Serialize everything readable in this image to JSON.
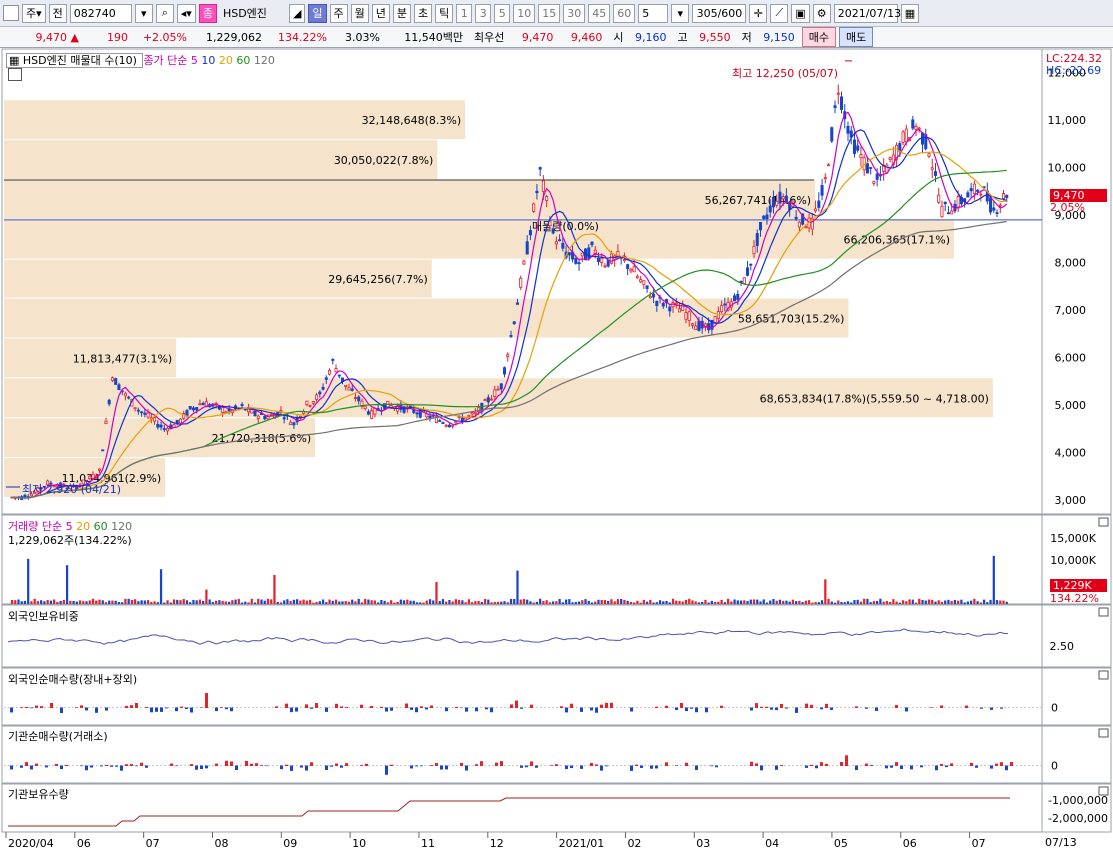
{
  "toolbar": {
    "period_type": "주",
    "prev_label": "전",
    "code": "082740",
    "name": "HSD엔진",
    "name_badge": "종",
    "periods": [
      "일",
      "주",
      "월",
      "년",
      "분",
      "초",
      "틱"
    ],
    "intervals": [
      "1",
      "3",
      "5",
      "10",
      "15",
      "30",
      "45",
      "60"
    ],
    "interval_value": "5",
    "count": "305",
    "count_max": "600",
    "date": "2021/07/13"
  },
  "quote": {
    "price": "9,470",
    "change": "190",
    "change_pct": "+2.05%",
    "volume": "1,229,062",
    "volume_ratio": "134.22%",
    "turnover": "3.03%",
    "amount": "11,540백만",
    "best_label": "최우선",
    "ask": "9,470",
    "bid": "9,460",
    "open_label": "시",
    "open": "9,160",
    "high_label": "고",
    "high": "9,550",
    "low_label": "저",
    "low": "9,150",
    "buy": "매수",
    "sell": "매도"
  },
  "main_pane": {
    "vp_label": "HSD엔진 매물대 수(10)",
    "ma_label": "종가 단순",
    "ma_periods": [
      "5",
      "10",
      "20",
      "60",
      "120"
    ],
    "ma_colors": [
      "#d000c0",
      "#1030d0",
      "#e8a000",
      "#209020",
      "#707070"
    ],
    "lc": "LC:224.32",
    "hc": "HC:-22.69",
    "high_note": "최고 12,250 (05/07)",
    "low_note": "최저 2,920 (04/21)",
    "price_axis": [
      "12,000",
      "11,000",
      "10,000",
      "9,000",
      "8,000",
      "7,000",
      "6,000",
      "5,000",
      "4,000",
      "3,000"
    ],
    "last_price": "9,470",
    "last_pct": "2.05%"
  },
  "volume_profile": [
    {
      "label": "68,653,834(17.8%)(5,559.50 ~ 4,718.00)",
      "pct": 17.8,
      "lo": 4718,
      "hi": 5559.5
    },
    {
      "label": "58,651,703(15.2%)",
      "pct": 15.2,
      "lo": 6400,
      "hi": 7240
    },
    {
      "label": "66,206,365(17.1%)",
      "pct": 17.1,
      "lo": 8060,
      "hi": 8900
    },
    {
      "label": "56,267,741(14.6%)",
      "pct": 14.6,
      "lo": 8900,
      "hi": 9740
    },
    {
      "label": "29,645,256(7.7%)",
      "pct": 7.7,
      "lo": 7240,
      "hi": 8060
    },
    {
      "label": "30,050,022(7.8%)",
      "pct": 7.8,
      "lo": 9740,
      "hi": 10580
    },
    {
      "label": "32,148,648(8.3%)",
      "pct": 8.3,
      "lo": 10580,
      "hi": 11420
    },
    {
      "label": "21,720,318(5.6%)",
      "pct": 5.6,
      "lo": 3880,
      "hi": 4718
    },
    {
      "label": "11,813,477(3.1%)",
      "pct": 3.1,
      "lo": 5559.5,
      "hi": 6400
    },
    {
      "label": "11,034,961(2.9%)",
      "pct": 2.9,
      "lo": 3040,
      "hi": 3880
    }
  ],
  "vp_overlay_text": "매물량(0.0%)",
  "volume_pane": {
    "title": "거래량",
    "ma_label": "단순",
    "ma_periods": [
      "5",
      "20",
      "60",
      "120"
    ],
    "value_text": "1,229,062주(134.22%)",
    "axis": [
      "15,000K",
      "10,000K"
    ],
    "last_value": "1,229K",
    "last_pct": "134.22%"
  },
  "foreign_ratio_pane": {
    "title": "외국인보유비중",
    "axis": [
      "2.50"
    ]
  },
  "foreign_net_pane": {
    "title": "외국인순매수량(장내+장외)",
    "axis": [
      "0"
    ]
  },
  "inst_net_pane": {
    "title": "기관순매수량(거래소)",
    "axis": [
      "0"
    ]
  },
  "inst_hold_pane": {
    "title": "기관보유수량",
    "axis": [
      "-1,000,000",
      "-2,000,000"
    ]
  },
  "x_axis": [
    "2020/04",
    "06",
    "07",
    "08",
    "09",
    "10",
    "11",
    "12",
    "2021/01",
    "02",
    "03",
    "04",
    "05",
    "06",
    "07"
  ],
  "x_axis_end": "07/13",
  "colors": {
    "up": "#e8202a",
    "down": "#1844c8",
    "vp_fill": "#f5e3cc",
    "accent": "#ff4fb9"
  },
  "chart_data": {
    "type": "candlestick",
    "y_range": [
      2700,
      12500
    ],
    "description_ma": [
      "5",
      "10",
      "20",
      "60",
      "120"
    ],
    "close_series": [
      3050,
      3150,
      3350,
      3300,
      3250,
      3400,
      3600,
      5600,
      5200,
      4900,
      4700,
      4500,
      4600,
      4900,
      5050,
      4950,
      4850,
      4950,
      4800,
      4750,
      4850,
      4600,
      5000,
      5200,
      5900,
      5400,
      5100,
      4800,
      5000,
      4950,
      4900,
      4800,
      4700,
      4600,
      4700,
      4800,
      5100,
      5400,
      6800,
      8300,
      9900,
      8600,
      8200,
      8000,
      8300,
      8000,
      8100,
      7900,
      7500,
      7200,
      7100,
      7000,
      6700,
      6600,
      7000,
      7200,
      7800,
      8700,
      9300,
      9400,
      8900,
      8800,
      9700,
      11700,
      10600,
      10100,
      9700,
      10100,
      10600,
      10900,
      10400,
      9100,
      9200,
      9400,
      9600,
      9100,
      9470
    ],
    "high": "12,250",
    "low": "2,920"
  }
}
